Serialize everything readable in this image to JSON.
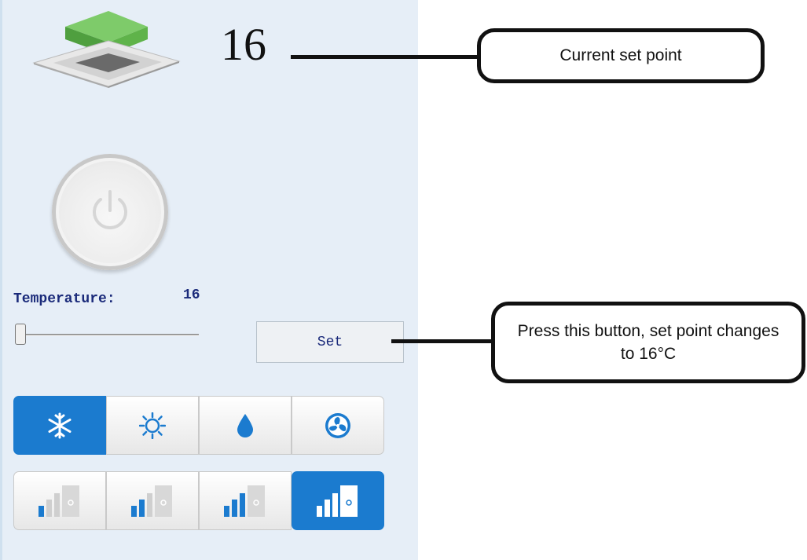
{
  "display": {
    "setpoint": "16"
  },
  "temperature": {
    "label": "Temperature:",
    "value": "16",
    "slider_level": 0
  },
  "buttons": {
    "set_label": "Set"
  },
  "modes": {
    "items": [
      "cool-snowflake-icon",
      "heat-sun-icon",
      "dry-drop-icon",
      "fan-icon"
    ],
    "active": 0
  },
  "fan_speeds": {
    "count": 4,
    "active": 3
  },
  "annotations": {
    "current_set_point": "Current set point",
    "set_button_note": "Press this button, set point changes to 16°C"
  },
  "colors": {
    "accent": "#1b7bcf",
    "text_dark_blue": "#1a2a7a",
    "panel_bg": "#e6eef7"
  }
}
